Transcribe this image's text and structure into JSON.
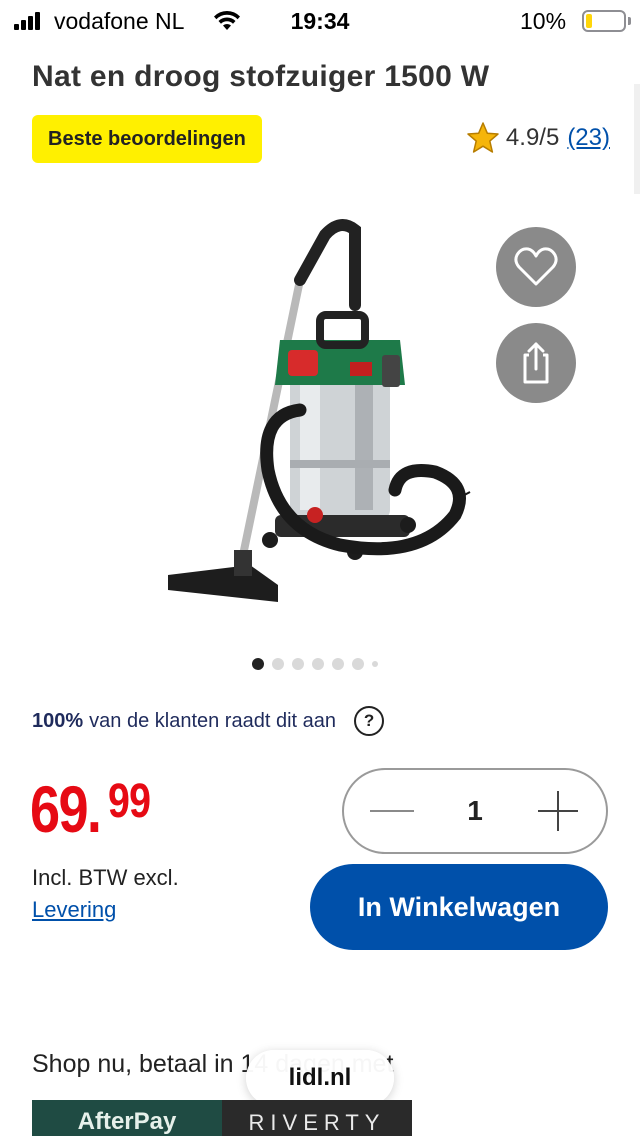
{
  "status_bar": {
    "carrier": "vodafone NL",
    "time": "19:34",
    "battery_percent": "10%",
    "battery_color": "#ffd60a"
  },
  "product": {
    "title": "Nat en droog stofzuiger 1500 W",
    "badge": "Beste beoordelingen",
    "rating_value": "4.9/5",
    "rating_count": "(23)",
    "image_icon": "vacuum-cleaner-image",
    "gallery": {
      "total_dots": 7,
      "active_index": 0
    }
  },
  "actions": {
    "favorite_icon": "heart-icon",
    "share_icon": "share-icon"
  },
  "recommend": {
    "percent": "100%",
    "text": "van de klanten raadt dit aan",
    "help": "?"
  },
  "price": {
    "integer": "69.",
    "decimal": "99",
    "vat_line": "Incl. BTW excl.",
    "delivery_link": "Levering"
  },
  "quantity": {
    "value": "1",
    "minus_icon": "minus-icon",
    "plus_icon": "plus-icon"
  },
  "cart_button": "In Winkelwagen",
  "payment": {
    "headline": "Shop nu, betaal in 14 dagen met",
    "afterpay": "AfterPay",
    "riverty": "RIVERTY"
  },
  "browser": {
    "url": "lidl.nl"
  },
  "colors": {
    "brand_blue": "#0050aa",
    "price_red": "#e60a14",
    "badge_yellow": "#fff000"
  }
}
